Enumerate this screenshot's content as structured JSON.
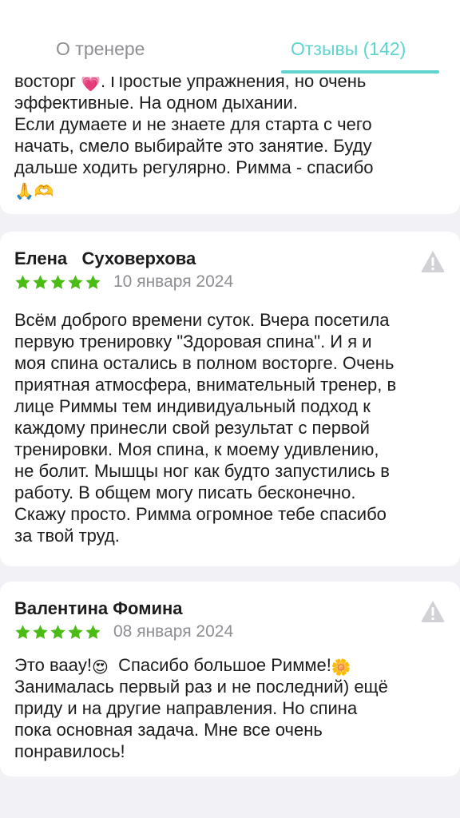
{
  "tabs": {
    "about_label": "О тренере",
    "reviews_label": "Отзывы (142)",
    "active_color": "#5fd4cf"
  },
  "partial_review": {
    "line1_before": "восторг ",
    "line1_emoji": "💗",
    "line1_after": ". Простые упражнения, но очень",
    "line2": "эффективные. На одном дыхании.",
    "line3": "Если думаете и не знаете для старта с чего",
    "line4": "начать, смело выбирайте это занятие. Буду",
    "line5": "дальше ходить регулярно. Римма - спасибо",
    "line6_emoji": "🙏🫶"
  },
  "reviews": [
    {
      "author": "Елена   Суховерхова",
      "stars": 5,
      "date": "10 января 2024",
      "text": "Всём доброго времени суток. Вчера посетила\nпервую тренировку \"Здоровая спина\". И я и\nмоя спина остались в полном восторге. Очень\nприятная атмосфера, внимательный тренер, в\nлице Риммы тем индивидуальный подход к\nкаждому принесли свой результат с первой\nтренировки. Моя спина, к моему удивлению,\nне болит. Мышцы ног как будто запустились в\nработу. В общем могу писать бесконечно.\nСкажу просто. Римма огромное тебе спасибо\nза твой труд."
    },
    {
      "author": "Валентина Фомина",
      "stars": 5,
      "date": "08 января 2024",
      "line1_before": "Это вааy!",
      "line1_emoji1": "😍",
      "line1_middle": "  Спасибо большое Римме!",
      "line1_emoji2": "🌼",
      "rest": "Занималась первый раз и не последний) ещё\nприду и на другие направления. Но спина\nпока основная задача. Мне все очень\nпонравилось!"
    }
  ],
  "colors": {
    "star": "#4cbb17",
    "background": "#f2f2f6",
    "card": "#ffffff",
    "muted_text": "#8e8e93"
  },
  "icons": {
    "star": "star-icon",
    "report": "warning-icon"
  }
}
